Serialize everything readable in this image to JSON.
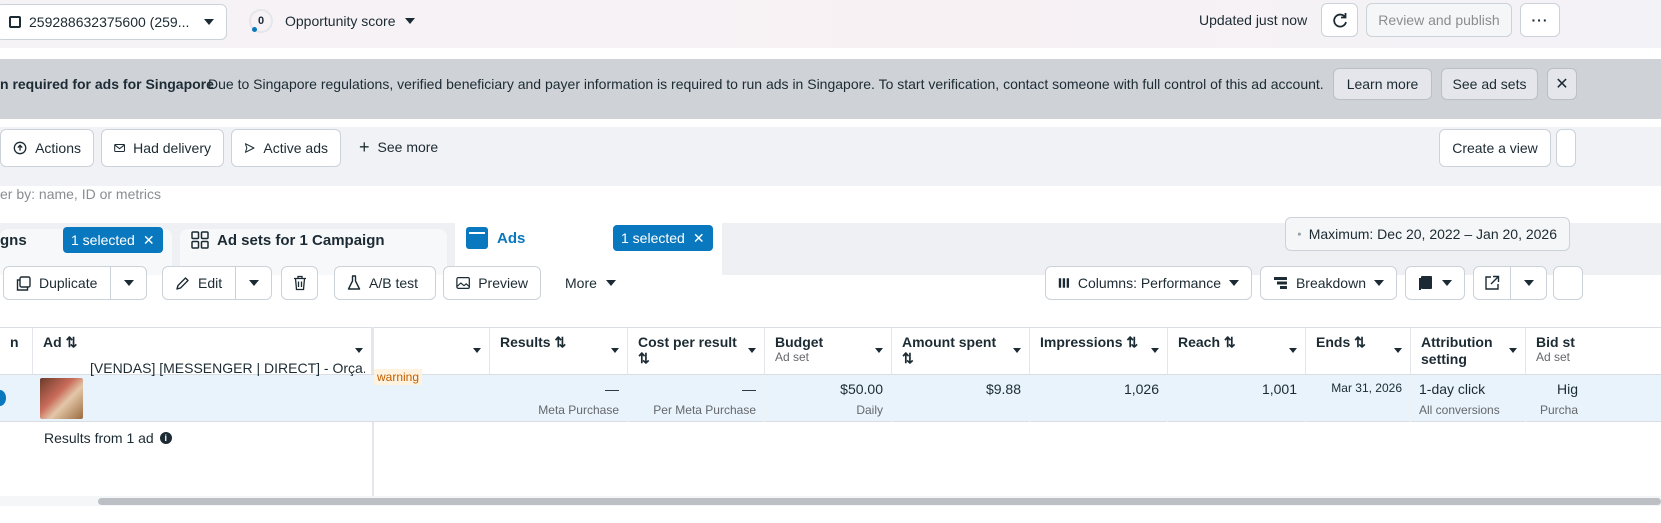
{
  "topbar": {
    "account_label": "259288632375600 (259...",
    "score_value": "0",
    "score_label": "Opportunity score",
    "updated_text": "Updated just now",
    "review_publish_label": "Review and publish"
  },
  "banner": {
    "title": "n required for ads for Singapore",
    "message": "Due to Singapore regulations, verified beneficiary and payer information is required to run ads in Singapore. To start verification, contact someone with full control of this ad account.",
    "learn_more": "Learn more",
    "see_ad_sets": "See ad sets"
  },
  "filters": {
    "actions": "Actions",
    "had_delivery": "Had delivery",
    "active_ads": "Active ads",
    "see_more": "See more",
    "create_view": "Create a view"
  },
  "search": {
    "placeholder": "er by: name, ID or metrics"
  },
  "tabs": {
    "campaigns_label": "gns",
    "campaigns_chip": "1 selected",
    "adsets_label": "Ad sets for 1 Campaign",
    "ads_label": "Ads",
    "ads_chip": "1 selected",
    "date_range": "Maximum: Dec 20, 2022 – Jan 20, 2026"
  },
  "toolbar": {
    "duplicate": "Duplicate",
    "edit": "Edit",
    "ab_test": "A/B test",
    "preview": "Preview",
    "more": "More",
    "columns": "Columns: Performance",
    "breakdown": "Breakdown"
  },
  "table": {
    "headers": {
      "first": "n",
      "ad": "Ad",
      "results": "Results",
      "cost_per_result": "Cost per result",
      "budget": "Budget",
      "budget_sub": "Ad set",
      "amount_spent": "Amount spent",
      "impressions": "Impressions",
      "reach": "Reach",
      "ends": "Ends",
      "attribution": "Attribution setting",
      "bid": "Bid st",
      "bid_sub": "Ad set"
    },
    "row": {
      "ad_name": "[VENDAS] [MESSENGER | DIRECT] - Orça...",
      "warning": "warning",
      "results": "—",
      "results_sub": "Meta Purchase",
      "cost": "—",
      "cost_sub": "Per Meta Purchase",
      "budget": "$50.00",
      "budget_sub": "Daily",
      "spent": "$9.88",
      "impressions": "1,026",
      "reach": "1,001",
      "ends": "Mar 31, 2026",
      "attribution": "1-day click",
      "attribution_sub": "All conversions",
      "bid": "Hig",
      "bid_sub": "Purcha"
    },
    "summary": "Results from 1 ad"
  },
  "colors": {
    "primary": "#0a78be",
    "banner_bg": "#cfd3d8",
    "warning": "#c25d00"
  }
}
